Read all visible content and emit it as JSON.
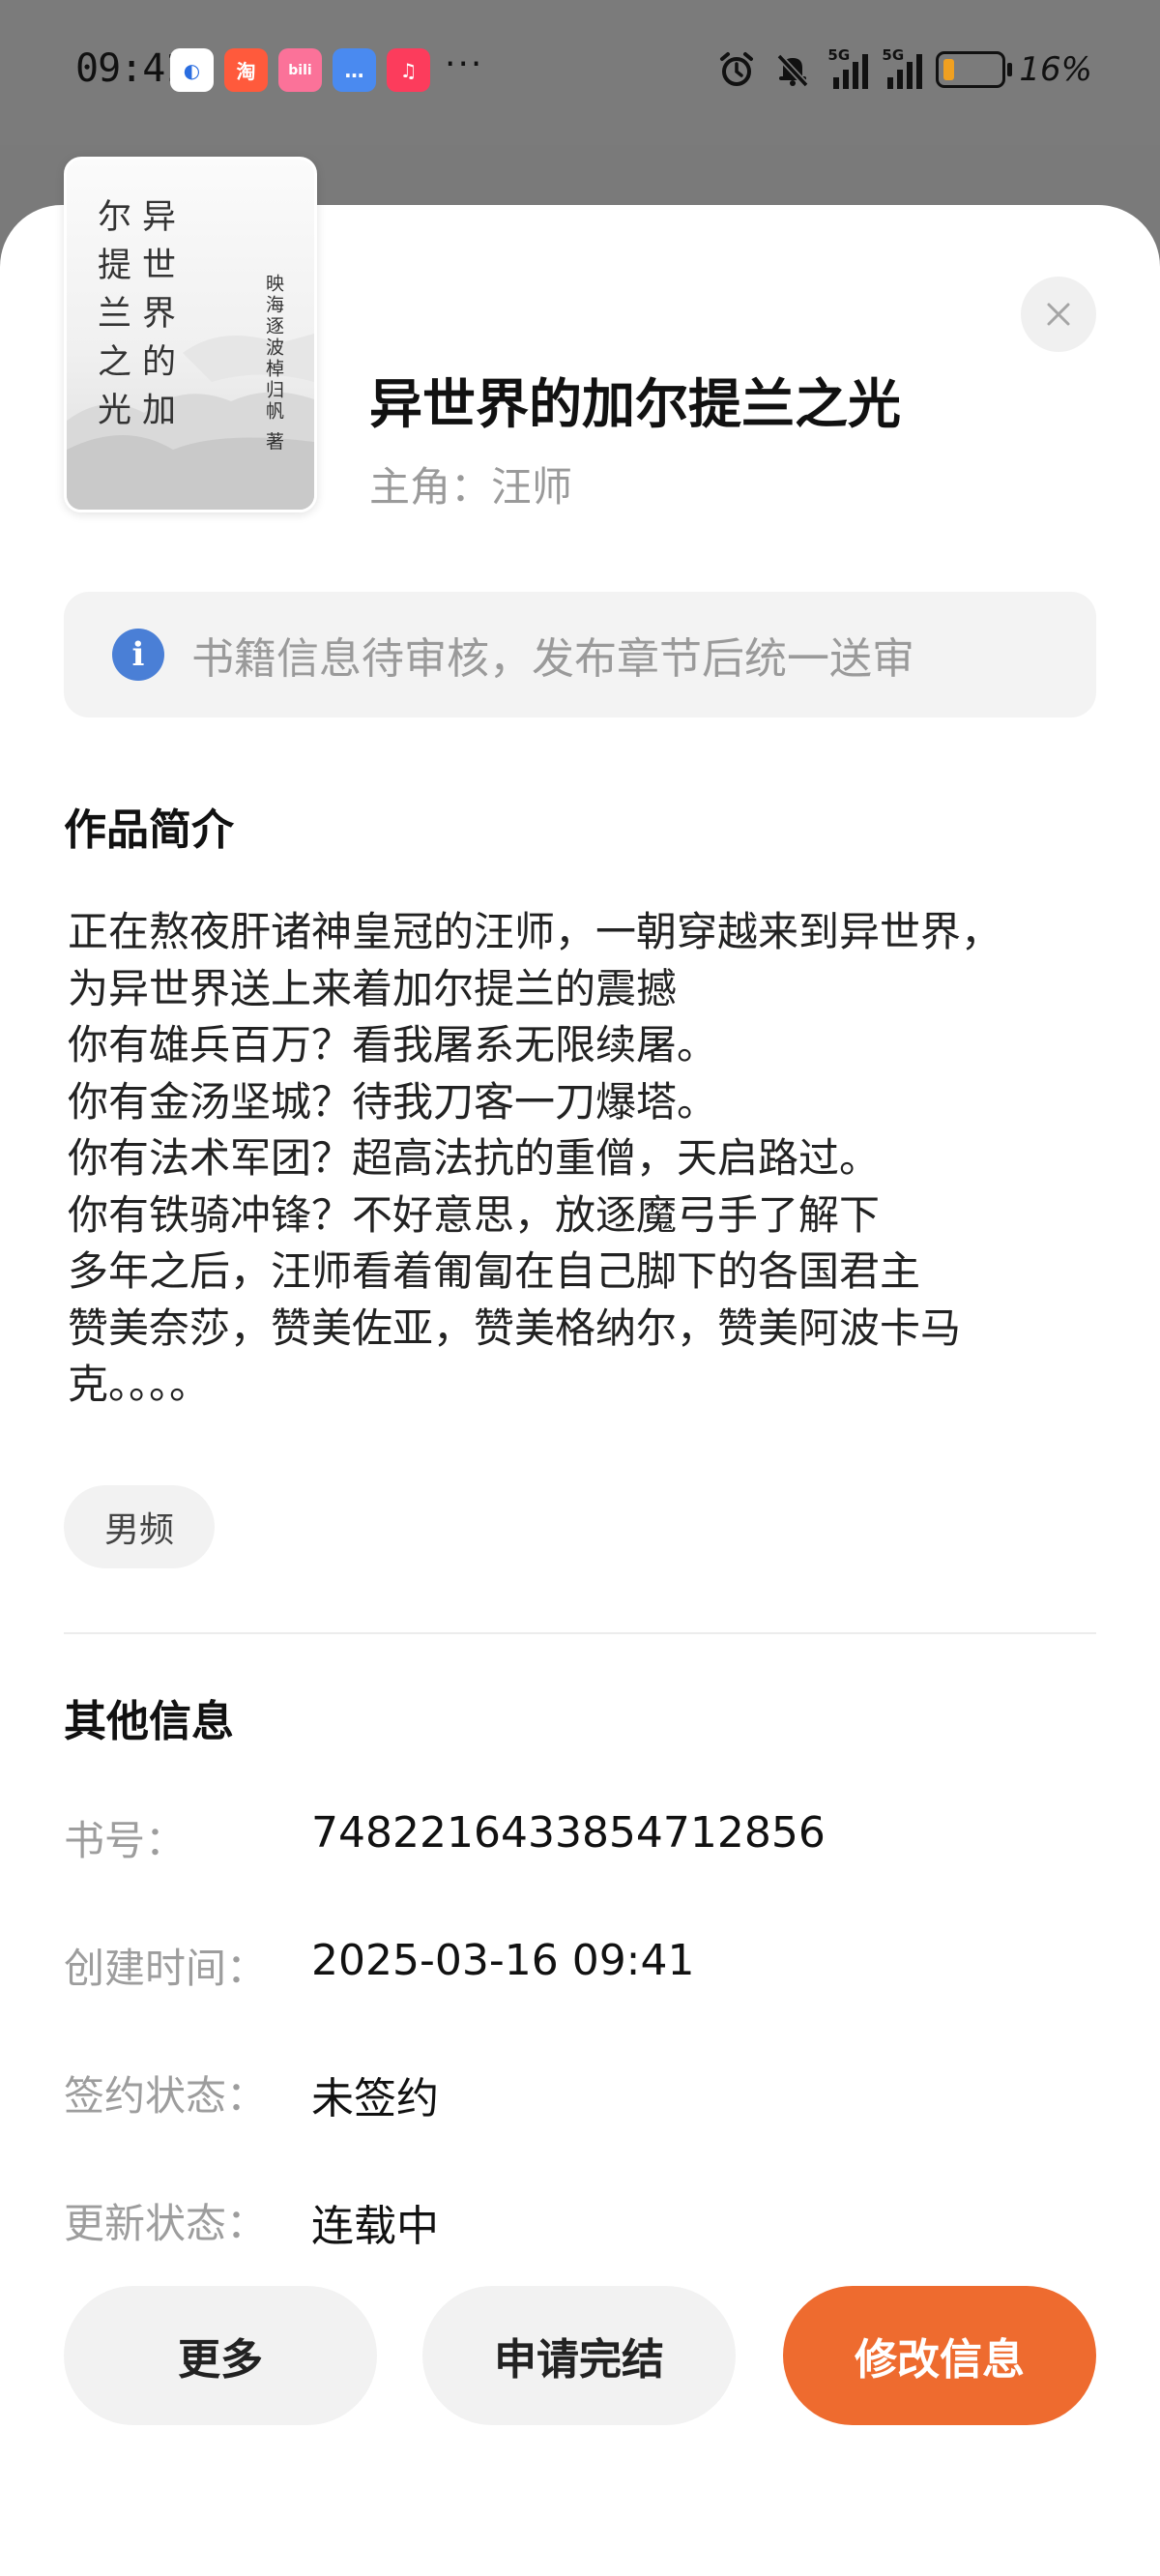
{
  "status_bar": {
    "time": "09:41",
    "apps": [
      {
        "name": "qq-browser-icon",
        "glyph": "◐",
        "color": "#ffffff",
        "fg": "#2a6de0"
      },
      {
        "name": "taobao-icon",
        "glyph": "淘",
        "color": "#ff5a3c",
        "fg": "#ffffff"
      },
      {
        "name": "bilibili-icon",
        "glyph": "bili",
        "color": "#fb7299",
        "fg": "#ffffff"
      },
      {
        "name": "messages-icon",
        "glyph": "…",
        "color": "#4a8af0",
        "fg": "#ffffff"
      },
      {
        "name": "music-icon",
        "glyph": "♫",
        "color": "#fc3c5c",
        "fg": "#ffffff"
      }
    ],
    "more": "···",
    "network_1": "5G",
    "network_2": "5G",
    "battery_percent": "16%"
  },
  "book": {
    "cover_title_col1": "异世界的加",
    "cover_title_col2": "尔提兰之光",
    "cover_author": "映海逐波棹归帆 著",
    "title": "异世界的加尔提兰之光",
    "protagonist": "主角：汪师"
  },
  "notice": {
    "icon": "i",
    "text": "书籍信息待审核，发布章节后统一送审"
  },
  "synopsis": {
    "heading": "作品简介",
    "lines": [
      "正在熬夜肝诸神皇冠的汪师，一朝穿越来到异世界，",
      "为异世界送上来着加尔提兰的震撼",
      "你有雄兵百万？看我屠系无限续屠。",
      "你有金汤坚城？待我刀客一刀爆塔。",
      "你有法术军团？超高法抗的重僧，天启路过。",
      "你有铁骑冲锋？不好意思，放逐魔弓手了解下",
      "多年之后，汪师看着匍匐在自己脚下的各国君主",
      "赞美奈莎，赞美佐亚，赞美格纳尔，赞美阿波卡马",
      "克。。。。"
    ]
  },
  "tag": "男频",
  "other_info": {
    "heading": "其他信息",
    "rows": [
      {
        "label": "书号：",
        "value": "7482216433854712856"
      },
      {
        "label": "创建时间：",
        "value": "2025-03-16 09:41"
      },
      {
        "label": "签约状态：",
        "value": "未签约"
      },
      {
        "label": "更新状态：",
        "value": "连载中"
      }
    ]
  },
  "actions": {
    "more": "更多",
    "apply_finish": "申请完结",
    "edit_info": "修改信息"
  },
  "colors": {
    "accent": "#ee6b2f",
    "info_icon": "#4a7fd6"
  }
}
